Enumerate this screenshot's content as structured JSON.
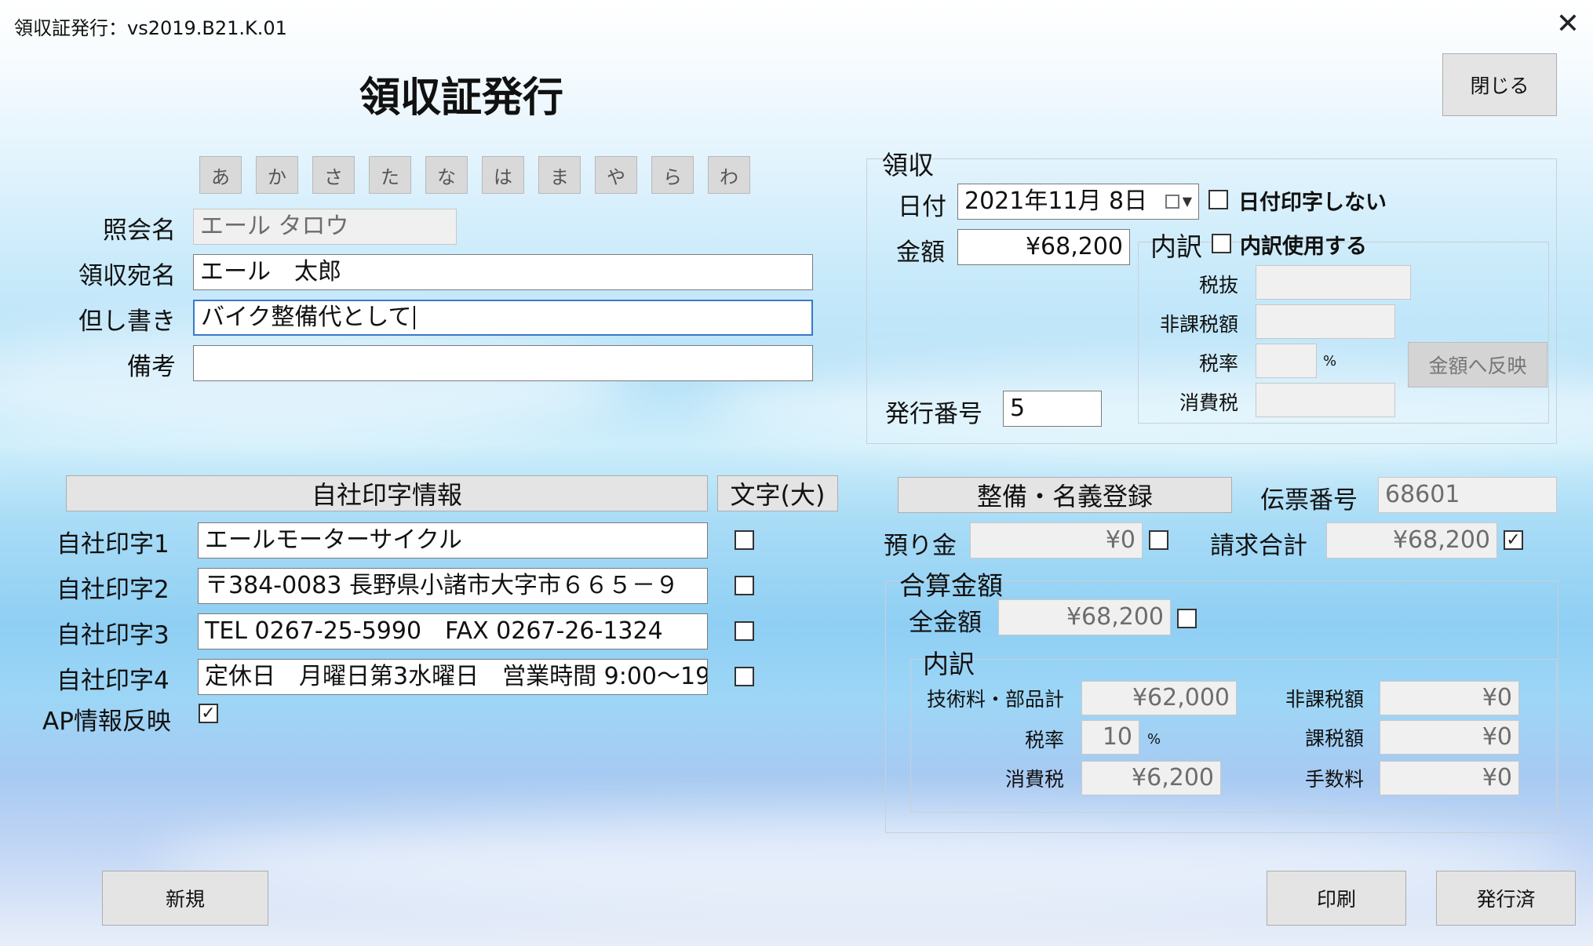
{
  "window": {
    "title": "領収証発行：vs2019.B21.K.01",
    "close_glyph": "✕"
  },
  "header": {
    "page_title": "領収証発行",
    "close_button": "閉じる"
  },
  "kana_buttons": [
    "あ",
    "か",
    "さ",
    "た",
    "な",
    "は",
    "ま",
    "や",
    "ら",
    "わ"
  ],
  "customer": {
    "inquiry_label": "照会名",
    "inquiry_value": "エール タロウ",
    "addressee_label": "領収宛名",
    "addressee_value": "エール　太郎",
    "proviso_label": "但し書き",
    "proviso_value": "バイク整備代として",
    "remarks_label": "備考",
    "remarks_value": ""
  },
  "company_print": {
    "header_button": "自社印字情報",
    "large_text_button": "文字(大)",
    "rows": [
      {
        "label": "自社印字1",
        "value": "エールモーターサイクル",
        "checked": false
      },
      {
        "label": "自社印字2",
        "value": "〒384-0083 長野県小諸市大字市６６５－９",
        "checked": false
      },
      {
        "label": "自社印字3",
        "value": "TEL 0267-25-5990　FAX 0267-26-1324",
        "checked": false
      },
      {
        "label": "自社印字4",
        "value": "定休日　月曜日第3水曜日　営業時間 9:00〜19",
        "checked": false
      }
    ],
    "ap_label": "AP情報反映",
    "ap_checked": true
  },
  "receipt": {
    "group_label": "領収",
    "date_label": "日付",
    "date_value": "2021年11月  8日",
    "no_date_label": "日付印字しない",
    "amount_label": "金額",
    "amount_value": "¥68,200",
    "breakdown_label": "内訳",
    "use_breakdown_label": "内訳使用する",
    "tax_excl_label": "税抜",
    "nontax_label": "非課税額",
    "rate_label": "税率",
    "percent": "%",
    "ctax_label": "消費税",
    "reflect_button": "金額へ反映",
    "issue_no_label": "発行番号",
    "issue_no_value": "5"
  },
  "maintenance": {
    "button": "整備・名義登録",
    "slip_label": "伝票番号",
    "slip_value": "68601",
    "deposit_label": "預り金",
    "deposit_value": "¥0",
    "deposit_checked": false,
    "billing_label": "請求合計",
    "billing_value": "¥68,200",
    "billing_checked": true
  },
  "combined": {
    "group_label": "合算金額",
    "total_label": "全金額",
    "total_value": "¥68,200",
    "total_checked": false,
    "breakdown_label": "内訳",
    "parts_label": "技術料・部品計",
    "parts_value": "¥62,000",
    "rate_label": "税率",
    "rate_value": "10",
    "percent": "%",
    "ctax_label": "消費税",
    "ctax_value": "¥6,200",
    "nontax_label": "非課税額",
    "nontax_value": "¥0",
    "taxable_label": "課税額",
    "taxable_value": "¥0",
    "fee_label": "手数料",
    "fee_value": "¥0"
  },
  "footer": {
    "new_button": "新規",
    "print_button": "印刷",
    "issued_button": "発行済"
  }
}
